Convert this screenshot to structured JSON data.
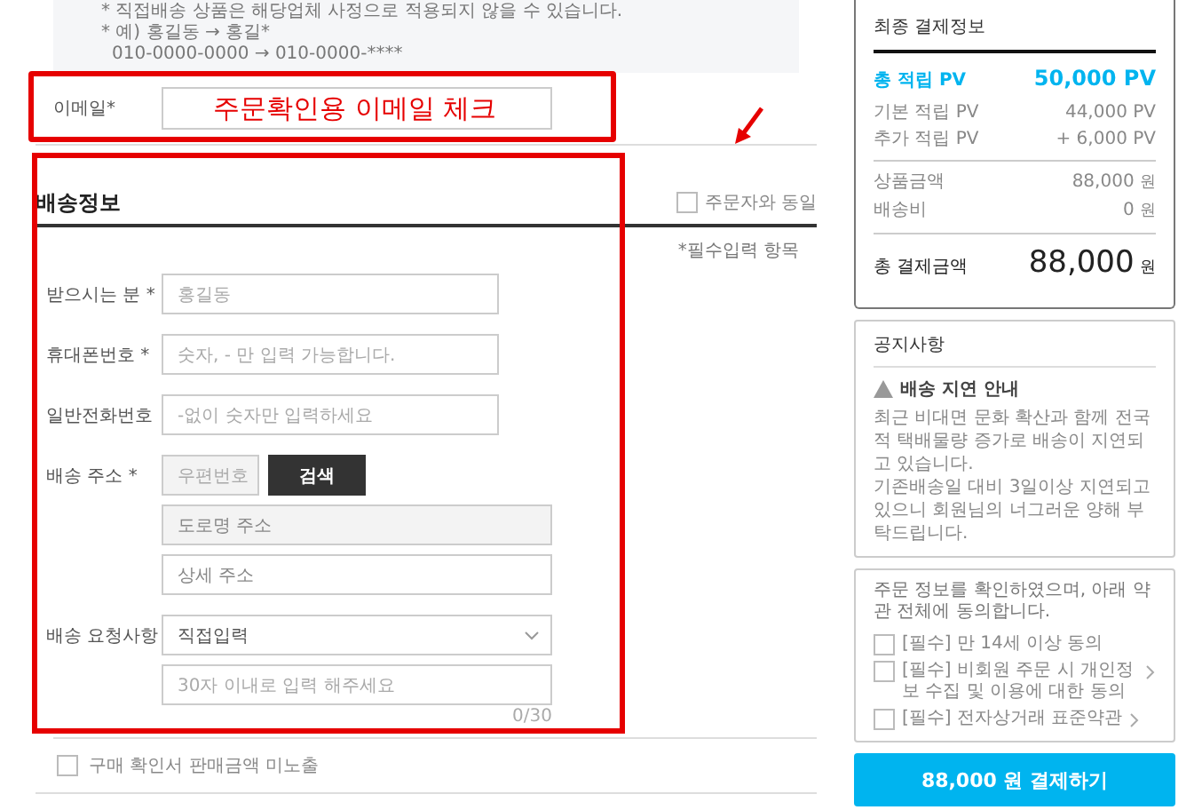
{
  "top_notice": {
    "lines": [
      "* 직접배송 상품은 해당업체 사정으로 적용되지 않을 수 있습니다.",
      "* 예) 홍길동 → 홍길*",
      "010-0000-0000 → 010-0000-****"
    ]
  },
  "email": {
    "label": "이메일*",
    "annotation": "주문확인용 이메일 체크"
  },
  "shipping": {
    "title": "배송정보",
    "same_as_orderer": {
      "label": "주문자와 동일",
      "checked": false
    },
    "required_note": "*필수입력 항목",
    "fields": [
      {
        "kind": "input",
        "label": "받으시는 분 *",
        "placeholder": "홍길동"
      },
      {
        "kind": "input",
        "label": "휴대폰번호 *",
        "placeholder": "숫자, - 만 입력 가능합니다."
      },
      {
        "kind": "input",
        "label": "일반전화번호",
        "placeholder": "-없이 숫자만 입력하세요"
      },
      {
        "kind": "address",
        "label": "배송 주소 *",
        "zip_placeholder": "우편번호",
        "search_button": "검색",
        "road_placeholder": "도로명 주소",
        "detail_placeholder": "상세 주소"
      },
      {
        "kind": "select",
        "label": "배송 요청사항",
        "value": "직접입력",
        "placeholder": "30자 이내로 입력 해주세요",
        "counter": "0/30"
      }
    ]
  },
  "hide_price": {
    "label": "구매 확인서 판매금액 미노출",
    "checked": false
  },
  "summary": {
    "title": "최종 결제정보",
    "groups": [
      [
        {
          "kind": "highlight",
          "label": "총 적립 PV",
          "value": "50,000 PV"
        },
        {
          "kind": "sub",
          "label": "기본 적립 PV",
          "value": "44,000 PV"
        },
        {
          "kind": "sub",
          "label": "추가 적립 PV",
          "value": "+ 6,000 PV"
        }
      ],
      [
        {
          "kind": "sub",
          "label": "상품금액",
          "value": "88,000",
          "unit": "원"
        },
        {
          "kind": "sub",
          "label": "배송비",
          "value": "0",
          "unit": "원"
        }
      ],
      [
        {
          "kind": "total",
          "label": "총 결제금액",
          "value": "88,000",
          "unit": "원"
        }
      ]
    ]
  },
  "notice": {
    "title": "공지사항",
    "heading": "배송 지연 안내",
    "paragraphs": [
      "최근 비대면 문화 확산과 함께 전국적 택배물량 증가로 배송이 지연되고 있습니다.",
      "기존배송일 대비 3일이상 지연되고 있으니 회원님의 너그러운 양해 부탁드립니다."
    ]
  },
  "agreements": {
    "intro": "주문 정보를 확인하였으며, 아래 약관 전체에 동의합니다.",
    "items": [
      {
        "label": "[필수] 만 14세 이상 동의",
        "checked": false,
        "link": false
      },
      {
        "label": "[필수] 비회원 주문 시 개인정보 수집 및 이용에 대한 동의",
        "checked": false,
        "link": true
      },
      {
        "label": "[필수] 전자상거래 표준약관",
        "checked": false,
        "link": true
      }
    ]
  },
  "pay_button": "88,000 원 결제하기"
}
